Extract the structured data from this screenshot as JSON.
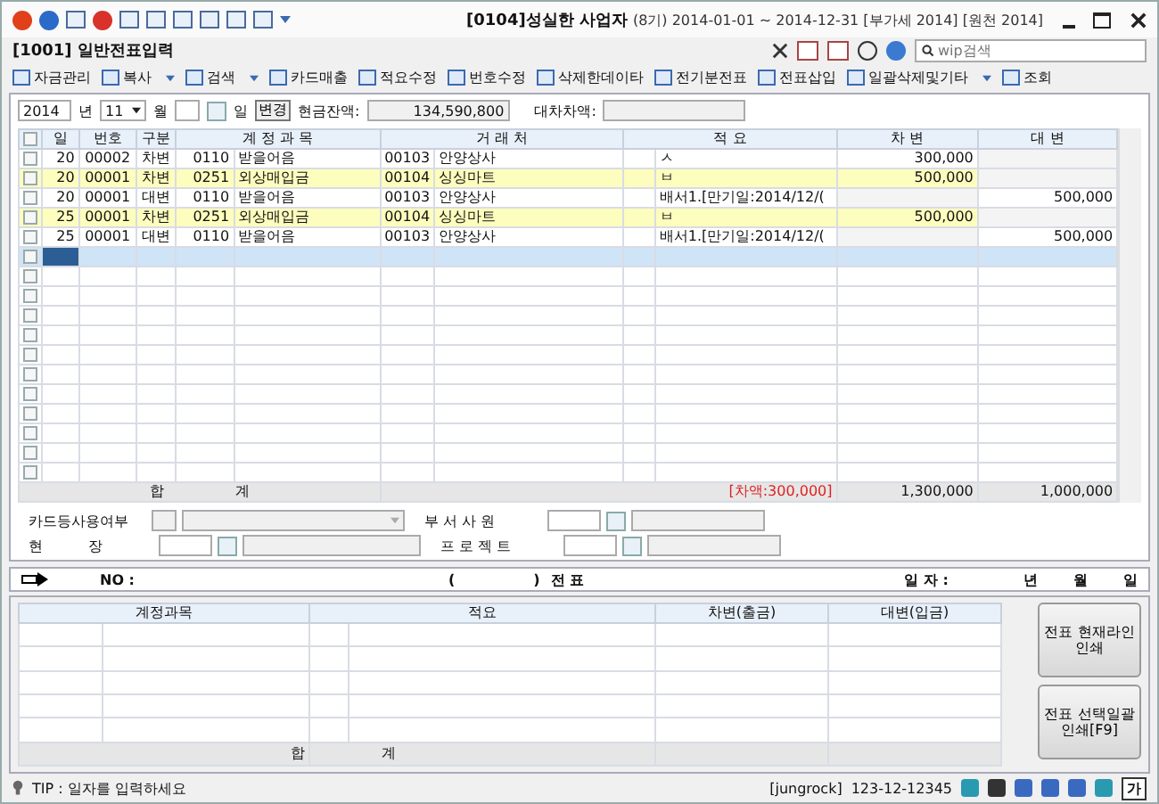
{
  "window": {
    "title": "[0104]성실한 사업자",
    "period": "(8기) 2014-01-01 ~ 2014-12-31 [부가세 2014] [원천 2014]",
    "screen_title": "[1001] 일반전표입력"
  },
  "search": {
    "placeholder": "wip검색"
  },
  "toolbar": [
    {
      "label": "자금관리",
      "menu": false
    },
    {
      "label": "복사",
      "menu": true
    },
    {
      "label": "검색",
      "menu": true
    },
    {
      "label": "카드매출",
      "menu": false
    },
    {
      "label": "적요수정",
      "menu": false
    },
    {
      "label": "번호수정",
      "menu": false
    },
    {
      "label": "삭제한데이타",
      "menu": false
    },
    {
      "label": "전기분전표",
      "menu": false
    },
    {
      "label": "전표삽입",
      "menu": false
    },
    {
      "label": "일괄삭제및기타",
      "menu": true
    },
    {
      "label": "조회",
      "menu": false
    }
  ],
  "filter": {
    "year": "2014",
    "year_unit": "년",
    "month": "11",
    "month_unit": "월",
    "day_unit": "일",
    "change_button": "변경",
    "cash_label": "현금잔액:",
    "cash_value": "134,590,800",
    "diff_label": "대차차액:"
  },
  "grid": {
    "columns": [
      "일",
      "번호",
      "구분",
      "계 정 과 목",
      "거 래 처",
      "적 요",
      "차 변",
      "대 변"
    ],
    "rows": [
      {
        "day": "20",
        "no": "00002",
        "type": "차변",
        "acct_code": "0110",
        "acct_name": "받을어음",
        "partner_code": "00103",
        "partner_name": "안양상사",
        "memo": "ㅅ",
        "debit": "300,000",
        "credit": "",
        "highlighted": false,
        "checked": false
      },
      {
        "day": "20",
        "no": "00001",
        "type": "차변",
        "acct_code": "0251",
        "acct_name": "외상매입금",
        "partner_code": "00104",
        "partner_name": "싱싱마트",
        "memo": "ㅂ",
        "debit": "500,000",
        "credit": "",
        "highlighted": true,
        "checked": false
      },
      {
        "day": "20",
        "no": "00001",
        "type": "대변",
        "acct_code": "0110",
        "acct_name": "받을어음",
        "partner_code": "00103",
        "partner_name": "안양상사",
        "memo": "배서1.[만기일:2014/12/(",
        "debit": "",
        "credit": "500,000",
        "highlighted": false,
        "checked": false
      },
      {
        "day": "25",
        "no": "00001",
        "type": "차변",
        "acct_code": "0251",
        "acct_name": "외상매입금",
        "partner_code": "00104",
        "partner_name": "싱싱마트",
        "memo": "ㅂ",
        "debit": "500,000",
        "credit": "",
        "highlighted": true,
        "checked": false
      },
      {
        "day": "25",
        "no": "00001",
        "type": "대변",
        "acct_code": "0110",
        "acct_name": "받을어음",
        "partner_code": "00103",
        "partner_name": "안양상사",
        "memo": "배서1.[만기일:2014/12/(",
        "debit": "",
        "credit": "500,000",
        "highlighted": false,
        "checked": false
      }
    ],
    "select_all": {
      "checked": false
    },
    "blank_rows": [
      {
        "checked": false,
        "selected": true
      },
      {
        "checked": false,
        "selected": false
      },
      {
        "checked": false,
        "selected": false
      },
      {
        "checked": false,
        "selected": false
      },
      {
        "checked": false,
        "selected": false
      },
      {
        "checked": false,
        "selected": false
      },
      {
        "checked": false,
        "selected": false
      },
      {
        "checked": false,
        "selected": false
      },
      {
        "checked": false,
        "selected": false
      },
      {
        "checked": false,
        "selected": false
      },
      {
        "checked": false,
        "selected": false
      },
      {
        "checked": false,
        "selected": false
      }
    ],
    "total": {
      "label_1": "합",
      "label_2": "계",
      "difference": "[차액:300,000]",
      "debit": "1,300,000",
      "credit": "1,000,000"
    }
  },
  "form": {
    "card_label": "카드등사용여부",
    "dept_label": "부 서 사 원",
    "site_label": "현          장",
    "project_label": "프 로 젝 트"
  },
  "voucher_bar": {
    "no_label": "NO :",
    "paren_open": "(",
    "paren_close": ")",
    "voucher": "전 표",
    "date_label": "일 자 :",
    "year": "년",
    "month": "월",
    "day": "일"
  },
  "print_grid": {
    "columns": [
      "계정과목",
      "적요",
      "차변(출금)",
      "대변(입금)"
    ],
    "total_1": "합",
    "total_2": "계"
  },
  "side_buttons": [
    "전표 현재라인 인쇄",
    "전표 선택일괄 인쇄[F9]"
  ],
  "status_bar": {
    "tip": "TIP : 일자를 입력하세요",
    "user": "[jungrock]",
    "biz_no": "123-12-12345",
    "ime": "가"
  }
}
